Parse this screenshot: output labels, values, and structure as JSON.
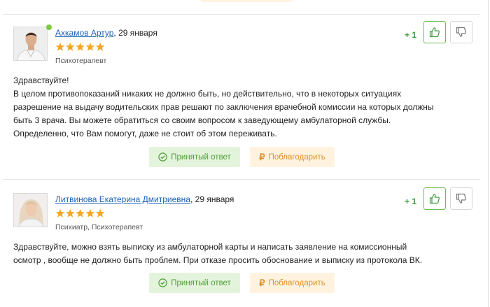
{
  "answers": [
    {
      "author": "Ахкамов Артур",
      "date": ", 29 января",
      "specialty": "Психотерапевт",
      "rating_stars": 5,
      "online": true,
      "votes": "+ 1",
      "text": "Здравствуйте!\nВ целом противопоказаний никаких не должно быть, но действительно, что в некоторых ситуациях\nразрешение на выдачу водительских прав решают по заключения врачебной комиссии на которых должны\nбыть 3 врача. Вы можете обратиться со своим вопросом к заведующему амбулаторной службы.\nОпределенно, что Вам помогут, даже не стоит об этом переживать.",
      "accepted_label": "Принятый ответ",
      "thank_label": "Поблагодарить",
      "thank_symbol": "₽"
    },
    {
      "author": "Литвинова Екатерина Дмитриевна",
      "date": ", 29 января",
      "specialty": "Психиатр, Психотерапевт",
      "rating_stars": 5,
      "online": false,
      "votes": "+ 1",
      "text": "Здравствуйте, можно взять выписку из амбулаторной карты и написать заявление на комиссионный\nосмотр , вообще не должно быть проблем. При отказе просить обоснование и выписку из протокола ВК.",
      "accepted_label": "Принятый ответ",
      "thank_label": "Поблагодарить",
      "thank_symbol": "₽"
    }
  ],
  "colors": {
    "link": "#1d62b5",
    "star": "#f5a623",
    "vote_green": "#3c9a3c",
    "accepted_bg": "#e4f4dc",
    "accepted_text": "#4e9f36",
    "thank_bg": "#fff3e0",
    "thank_text": "#e0902b"
  }
}
